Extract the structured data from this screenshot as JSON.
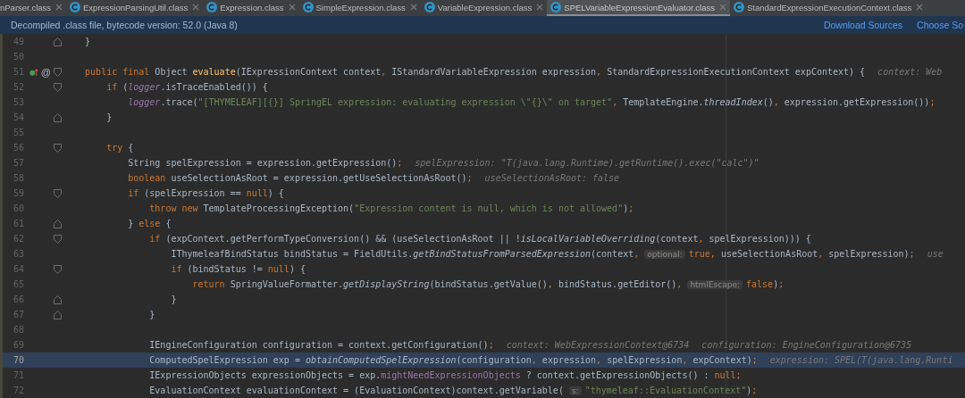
{
  "tabs": [
    {
      "label": "nParser.class",
      "selected": false,
      "icon": false
    },
    {
      "label": "ExpressionParsingUtil.class",
      "selected": false,
      "icon": true
    },
    {
      "label": "Expression.class",
      "selected": false,
      "icon": true
    },
    {
      "label": "SimpleExpression.class",
      "selected": false,
      "icon": true
    },
    {
      "label": "VariableExpression.class",
      "selected": false,
      "icon": true
    },
    {
      "label": "SPELVariableExpressionEvaluator.class",
      "selected": true,
      "icon": true
    },
    {
      "label": "StandardExpressionExecutionContext.class",
      "selected": false,
      "icon": true
    }
  ],
  "banner": {
    "message": "Decompiled .class file, bytecode version: 52.0 (Java 8)",
    "links": [
      "Download Sources",
      "Choose So"
    ]
  },
  "lines": [
    {
      "number": "49",
      "fold": {
        "kind": "end"
      },
      "segments": [
        {
          "kind": "code",
          "tokens": [
            {
              "kind": "plain",
              "text": "    }"
            }
          ]
        }
      ]
    },
    {
      "number": "50"
    },
    {
      "number": "51",
      "fold": {
        "kind": "start"
      },
      "override_marker": true,
      "gutter_text": "@",
      "segments": [
        {
          "kind": "code",
          "tokens": [
            {
              "kind": "keyword",
              "text": "    public final "
            },
            {
              "kind": "plain",
              "text": "Object "
            },
            {
              "kind": "declaration",
              "text": "evaluate"
            },
            {
              "kind": "plain",
              "text": "(IExpressionContext context"
            },
            {
              "kind": "keyword",
              "text": ", "
            },
            {
              "kind": "plain",
              "text": "IStandardVariableExpression expression"
            },
            {
              "kind": "keyword",
              "text": ", "
            },
            {
              "kind": "plain",
              "text": "StandardExpressionExecutionContext expContext) {"
            }
          ]
        },
        {
          "kind": "value",
          "text": "context: Web"
        }
      ]
    },
    {
      "number": "52",
      "fold": {
        "kind": "start"
      },
      "segments": [
        {
          "kind": "code",
          "tokens": [
            {
              "kind": "keyword",
              "text": "        if "
            },
            {
              "kind": "plain",
              "text": "("
            },
            {
              "kind": "field",
              "text": "logger"
            },
            {
              "kind": "plain",
              "text": ".isTraceEnabled()) {"
            }
          ]
        }
      ]
    },
    {
      "number": "53",
      "segments": [
        {
          "kind": "code",
          "tokens": [
            {
              "kind": "field",
              "text": "            logger"
            },
            {
              "kind": "plain",
              "text": ".trace("
            },
            {
              "kind": "string",
              "text": "\"[THYMELEAF][{}] SpringEL expression: evaluating expression \\\"{}\\\" on target\""
            },
            {
              "kind": "keyword",
              "text": ", "
            },
            {
              "kind": "plain",
              "text": "TemplateEngine."
            },
            {
              "kind": "static",
              "text": "threadIndex"
            },
            {
              "kind": "plain",
              "text": "()"
            },
            {
              "kind": "keyword",
              "text": ", "
            },
            {
              "kind": "plain",
              "text": "expression.getExpression())"
            },
            {
              "kind": "keyword",
              "text": ";"
            }
          ]
        }
      ]
    },
    {
      "number": "54",
      "fold": {
        "kind": "end"
      },
      "segments": [
        {
          "kind": "code",
          "tokens": [
            {
              "kind": "plain",
              "text": "        }"
            }
          ]
        }
      ]
    },
    {
      "number": "55"
    },
    {
      "number": "56",
      "fold": {
        "kind": "start"
      },
      "segments": [
        {
          "kind": "code",
          "tokens": [
            {
              "kind": "keyword",
              "text": "        try "
            },
            {
              "kind": "plain",
              "text": "{"
            }
          ]
        }
      ]
    },
    {
      "number": "57",
      "segments": [
        {
          "kind": "code",
          "tokens": [
            {
              "kind": "plain",
              "text": "            String spelExpression = expression.getExpression()"
            },
            {
              "kind": "keyword",
              "text": ";"
            }
          ]
        },
        {
          "kind": "value",
          "text": "spelExpression: \"T(java.lang.Runtime).getRuntime().exec(\"calc\")\""
        }
      ]
    },
    {
      "number": "58",
      "segments": [
        {
          "kind": "code",
          "tokens": [
            {
              "kind": "keyword",
              "text": "            boolean "
            },
            {
              "kind": "plain",
              "text": "useSelectionAsRoot = expression.getUseSelectionAsRoot()"
            },
            {
              "kind": "keyword",
              "text": ";"
            }
          ]
        },
        {
          "kind": "value",
          "text": "useSelectionAsRoot: false"
        }
      ]
    },
    {
      "number": "59",
      "fold": {
        "kind": "start"
      },
      "segments": [
        {
          "kind": "code",
          "tokens": [
            {
              "kind": "keyword",
              "text": "            if "
            },
            {
              "kind": "plain",
              "text": "(spelExpression == "
            },
            {
              "kind": "keyword",
              "text": "null"
            },
            {
              "kind": "plain",
              "text": ") {"
            }
          ]
        }
      ]
    },
    {
      "number": "60",
      "segments": [
        {
          "kind": "code",
          "tokens": [
            {
              "kind": "keyword",
              "text": "                throw new "
            },
            {
              "kind": "plain",
              "text": "TemplateProcessingException("
            },
            {
              "kind": "string",
              "text": "\"Expression content is null, which is not allowed\""
            },
            {
              "kind": "plain",
              "text": ")"
            },
            {
              "kind": "keyword",
              "text": ";"
            }
          ]
        }
      ]
    },
    {
      "number": "61",
      "fold": {
        "kind": "end"
      },
      "segments": [
        {
          "kind": "code",
          "tokens": [
            {
              "kind": "plain",
              "text": "            } "
            },
            {
              "kind": "keyword",
              "text": "else "
            },
            {
              "kind": "plain",
              "text": "{"
            }
          ]
        }
      ]
    },
    {
      "number": "62",
      "fold": {
        "kind": "start"
      },
      "segments": [
        {
          "kind": "code",
          "tokens": [
            {
              "kind": "keyword",
              "text": "                if "
            },
            {
              "kind": "plain",
              "text": "(expContext.getPerformTypeConversion() && (useSelectionAsRoot || !"
            },
            {
              "kind": "static",
              "text": "isLocalVariableOverriding"
            },
            {
              "kind": "plain",
              "text": "(context"
            },
            {
              "kind": "keyword",
              "text": ", "
            },
            {
              "kind": "plain",
              "text": "spelExpression))) {"
            }
          ]
        }
      ]
    },
    {
      "number": "63",
      "segments": [
        {
          "kind": "code",
          "tokens": [
            {
              "kind": "plain",
              "text": "                    IThymeleafBindStatus bindStatus = FieldUtils."
            },
            {
              "kind": "static",
              "text": "getBindStatusFromParsedExpression"
            },
            {
              "kind": "plain",
              "text": "(context"
            },
            {
              "kind": "keyword",
              "text": ","
            }
          ]
        },
        {
          "kind": "inlay",
          "text": "optional:"
        },
        {
          "kind": "code",
          "tokens": [
            {
              "kind": "keyword",
              "text": "true, "
            },
            {
              "kind": "plain",
              "text": "useSelectionAsRoot"
            },
            {
              "kind": "keyword",
              "text": ", "
            },
            {
              "kind": "plain",
              "text": "spelExpression)"
            },
            {
              "kind": "keyword",
              "text": ";"
            }
          ]
        },
        {
          "kind": "value",
          "text": "use"
        }
      ]
    },
    {
      "number": "64",
      "fold": {
        "kind": "start"
      },
      "segments": [
        {
          "kind": "code",
          "tokens": [
            {
              "kind": "keyword",
              "text": "                    if "
            },
            {
              "kind": "plain",
              "text": "(bindStatus != "
            },
            {
              "kind": "keyword",
              "text": "null"
            },
            {
              "kind": "plain",
              "text": ") {"
            }
          ]
        }
      ]
    },
    {
      "number": "65",
      "segments": [
        {
          "kind": "code",
          "tokens": [
            {
              "kind": "keyword",
              "text": "                        return "
            },
            {
              "kind": "plain",
              "text": "SpringValueFormatter."
            },
            {
              "kind": "static",
              "text": "getDisplayString"
            },
            {
              "kind": "plain",
              "text": "(bindStatus.getValue()"
            },
            {
              "kind": "keyword",
              "text": ", "
            },
            {
              "kind": "plain",
              "text": "bindStatus.getEditor()"
            },
            {
              "kind": "keyword",
              "text": ","
            }
          ]
        },
        {
          "kind": "inlay",
          "text": "htmlEscape:"
        },
        {
          "kind": "code",
          "tokens": [
            {
              "kind": "keyword",
              "text": "false"
            },
            {
              "kind": "plain",
              "text": ")"
            },
            {
              "kind": "keyword",
              "text": ";"
            }
          ]
        }
      ]
    },
    {
      "number": "66",
      "fold": {
        "kind": "end"
      },
      "segments": [
        {
          "kind": "code",
          "tokens": [
            {
              "kind": "plain",
              "text": "                    }"
            }
          ]
        }
      ]
    },
    {
      "number": "67",
      "fold": {
        "kind": "end"
      },
      "segments": [
        {
          "kind": "code",
          "tokens": [
            {
              "kind": "plain",
              "text": "                }"
            }
          ]
        }
      ]
    },
    {
      "number": "68"
    },
    {
      "number": "69",
      "segments": [
        {
          "kind": "code",
          "tokens": [
            {
              "kind": "plain",
              "text": "                IEngineConfiguration configuration = context.getConfiguration()"
            },
            {
              "kind": "keyword",
              "text": ";"
            }
          ]
        },
        {
          "kind": "value",
          "text": "context: WebExpressionContext@6734"
        },
        {
          "kind": "value",
          "text": "configuration: EngineConfiguration@6735"
        }
      ]
    },
    {
      "number": "70",
      "current": true,
      "segments": [
        {
          "kind": "code",
          "tokens": [
            {
              "kind": "plain",
              "text": "                ComputedSpelExpression exp = "
            },
            {
              "kind": "static",
              "text": "obtainComputedSpelExpression"
            },
            {
              "kind": "plain",
              "text": "(configuration"
            },
            {
              "kind": "keyword",
              "text": ", "
            },
            {
              "kind": "plain",
              "text": "expression"
            },
            {
              "kind": "keyword",
              "text": ", "
            },
            {
              "kind": "plain",
              "text": "spelExpression"
            },
            {
              "kind": "keyword",
              "text": ", "
            },
            {
              "kind": "plain",
              "text": "expContext)"
            },
            {
              "kind": "keyword",
              "text": ";"
            }
          ]
        },
        {
          "kind": "value",
          "text": "expression: SPEL(T(java.lang.Runti"
        }
      ]
    },
    {
      "number": "71",
      "segments": [
        {
          "kind": "code",
          "tokens": [
            {
              "kind": "plain",
              "text": "                IExpressionObjects expressionObjects = exp."
            },
            {
              "kind": "member",
              "text": "mightNeedExpressionObjects"
            },
            {
              "kind": "plain",
              "text": " ? context.getExpressionObjects() : "
            },
            {
              "kind": "keyword",
              "text": "null;"
            }
          ]
        }
      ]
    },
    {
      "number": "72",
      "segments": [
        {
          "kind": "code",
          "tokens": [
            {
              "kind": "plain",
              "text": "                EvaluationContext evaluationContext = (EvaluationContext)context.getVariable("
            }
          ]
        },
        {
          "kind": "inlay",
          "text": "s:"
        },
        {
          "kind": "code",
          "tokens": [
            {
              "kind": "string",
              "text": "\"thymeleaf::EvaluationContext\""
            },
            {
              "kind": "plain",
              "text": ")"
            },
            {
              "kind": "keyword",
              "text": ";"
            }
          ]
        }
      ]
    }
  ]
}
